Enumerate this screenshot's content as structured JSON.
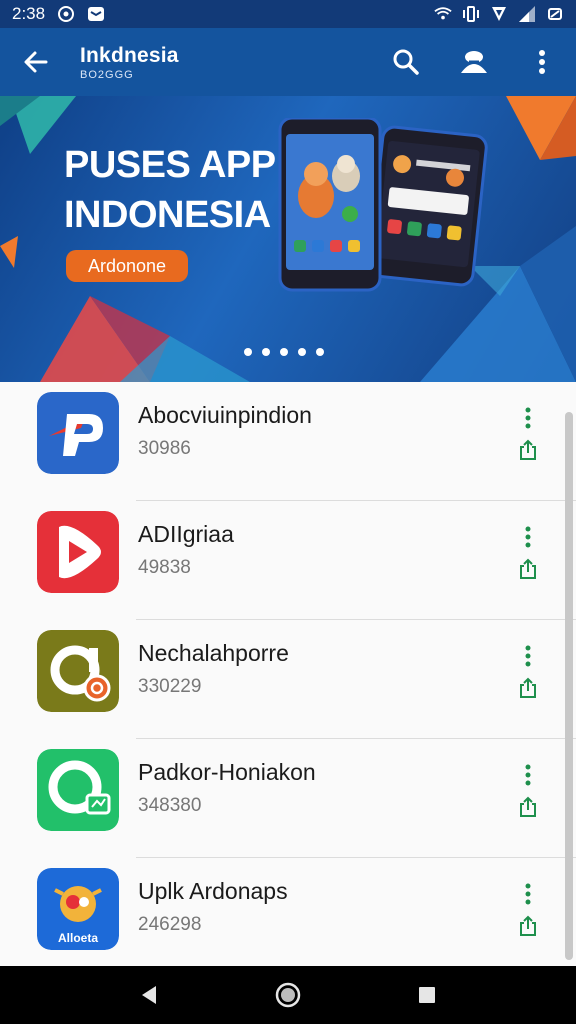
{
  "status_bar": {
    "time": "2:38",
    "icons": [
      "notification-icon",
      "message-icon",
      "wifi-icon",
      "vibrate-icon",
      "shield-icon",
      "signal-icon",
      "battery-icon"
    ]
  },
  "app_bar": {
    "title": "Inkdnesia",
    "subtitle": "BO2GGG",
    "icons": [
      "back-arrow-icon",
      "search-icon",
      "account-icon",
      "more-vert-icon"
    ]
  },
  "banner": {
    "headline_line1": "PUSES APP",
    "headline_line2": "INDONESIA",
    "cta_label": "Ardonone",
    "page_count": 5,
    "colors": {
      "accent": "#e86a1f",
      "background": "#1f67bd"
    }
  },
  "apps": [
    {
      "name": "Abocviuinpindion",
      "size": "30986",
      "icon": "blue-p-logo-icon",
      "color": "#2a67c9"
    },
    {
      "name": "ADIIgriaa",
      "size": "49838",
      "icon": "red-play-logo-icon",
      "color": "#e53039"
    },
    {
      "name": "Nechalahporre",
      "size": "330229",
      "icon": "olive-ring-logo-icon",
      "color": "#7a7a1a"
    },
    {
      "name": "Padkor-Honiakon",
      "size": "348380",
      "icon": "green-chat-logo-icon",
      "color": "#22c06a"
    },
    {
      "name": "Uplk Ardonaps",
      "size": "246298",
      "icon": "blue-mascot-logo-icon",
      "color": "#1d6ad8",
      "icon_text": "Alloeta"
    }
  ],
  "nav_bar": {
    "icons": [
      "back-triangle-icon",
      "home-circle-icon",
      "recents-square-icon"
    ]
  }
}
